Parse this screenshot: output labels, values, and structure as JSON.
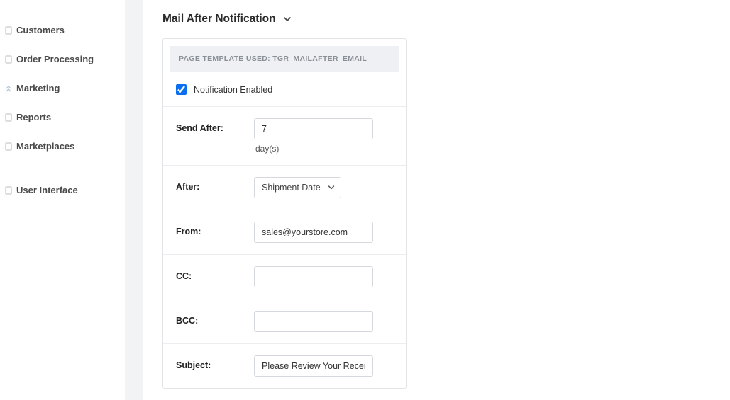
{
  "sidebar": {
    "items": [
      {
        "label": "Customers"
      },
      {
        "label": "Order Processing"
      },
      {
        "label": "Marketing"
      },
      {
        "label": "Reports"
      },
      {
        "label": "Marketplaces"
      },
      {
        "label": "User Interface"
      }
    ]
  },
  "page": {
    "title": "Mail After Notification"
  },
  "card": {
    "banner_prefix": "PAGE TEMPLATE USED:",
    "banner_template": "TGR_MAILAFTER_EMAIL",
    "notification_enabled_label": "Notification Enabled",
    "notification_enabled": true,
    "send_after_label": "Send After:",
    "send_after_value": "7",
    "send_after_hint": "day(s)",
    "after_label": "After:",
    "after_value": "Shipment Date",
    "from_label": "From:",
    "from_value": "sales@yourstore.com",
    "cc_label": "CC:",
    "cc_value": "",
    "bcc_label": "BCC:",
    "bcc_value": "",
    "subject_label": "Subject:",
    "subject_value": "Please Review Your Recent Order"
  }
}
